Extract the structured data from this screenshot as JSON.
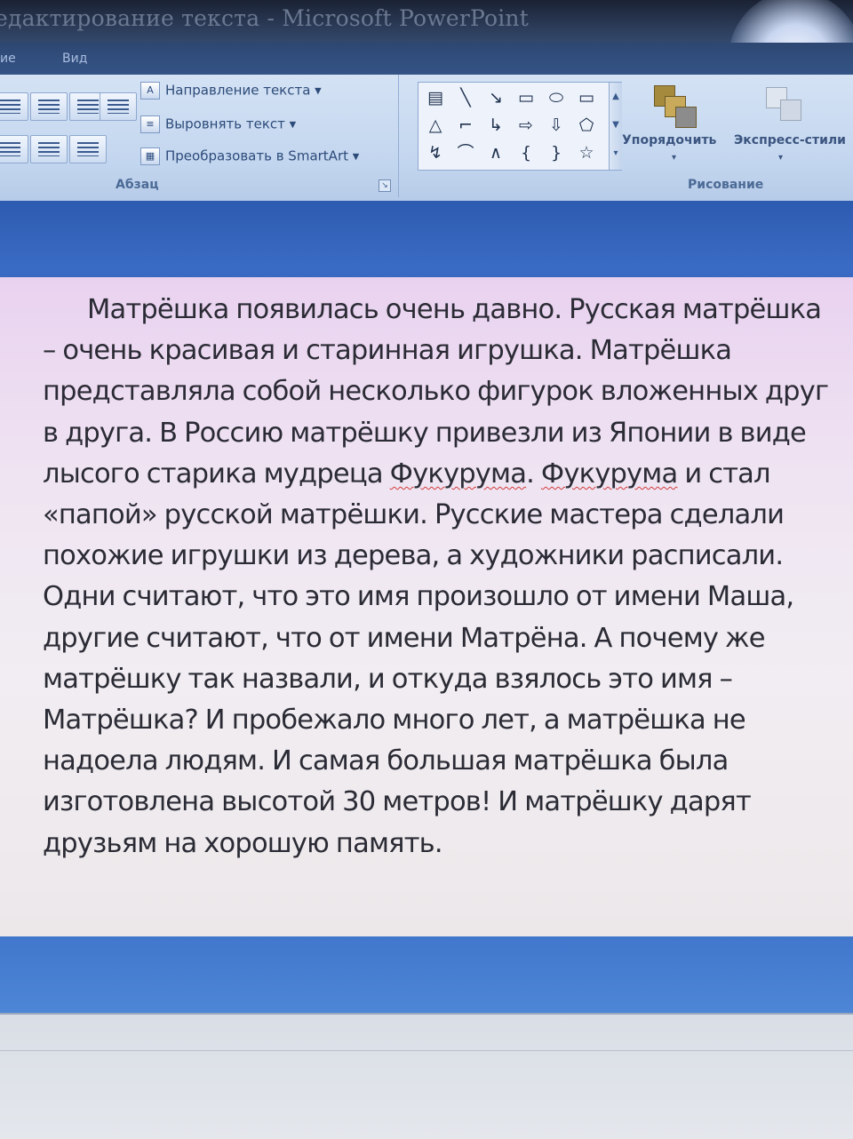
{
  "window": {
    "title": "едактирование текста - Microsoft PowerPoint"
  },
  "tabs": [
    {
      "label": "ие"
    },
    {
      "label": "Вид"
    }
  ],
  "ribbon": {
    "paragraph_group": {
      "label": "Абзац",
      "commands": [
        {
          "label": "Направление текста",
          "icon": "text-direction-icon"
        },
        {
          "label": "Выровнять текст",
          "icon": "align-text-icon"
        },
        {
          "label": "Преобразовать в SmartArt",
          "icon": "smartart-icon"
        }
      ]
    },
    "drawing_group": {
      "label": "Рисование",
      "arrange_label": "Упорядочить",
      "quick_styles_label": "Экспресс-стили",
      "shapes": [
        "▤",
        "╲",
        "↘",
        "▭",
        "⬭",
        "▭",
        "△",
        "⌐",
        "↳",
        "⇨",
        "⇩",
        "⬠",
        "↯",
        "⌒",
        "∧",
        "{",
        "}",
        "☆"
      ]
    }
  },
  "slide": {
    "text_segments": [
      {
        "text": "Матрёшка появилась очень давно.  Русская матрёшка – очень красивая и старинная игрушка. Матрёшка представляла собой несколько фигурок вложенных друг в друга. В Россию матрёшку привезли из Японии в виде лысого старика мудреца ",
        "spell": false
      },
      {
        "text": "Фукурума",
        "spell": true
      },
      {
        "text": ". ",
        "spell": false
      },
      {
        "text": "Фукурума",
        "spell": true
      },
      {
        "text": " и стал «папой» русской матрёшки. Русские мастера сделали похожие игрушки из дерева, а художники расписали.  Одни считают, что это имя произошло от имени Маша,  другие считают, что от имени Матрёна. А почему же матрёшку так назвали, и откуда взялось это имя – Матрёшка?  И пробежало много лет, а матрёшка не надоела людям. И самая большая матрёшка была изготовлена высотой 30 метров! И матрёшку дарят друзьям на хорошую память.",
        "spell": false
      }
    ]
  }
}
